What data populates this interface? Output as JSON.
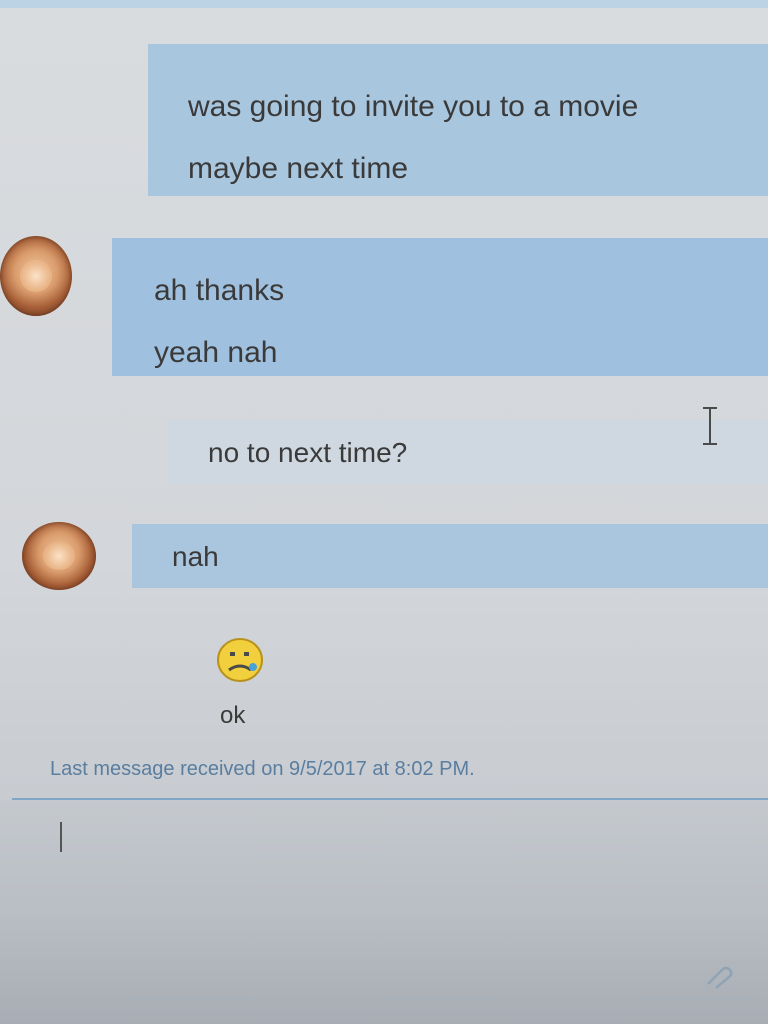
{
  "messages": [
    {
      "lines": [
        "was going to invite you to a movie",
        "maybe next time"
      ]
    },
    {
      "lines": [
        "ah thanks",
        "yeah nah"
      ]
    },
    {
      "lines": [
        "no to next time?"
      ]
    },
    {
      "lines": [
        "nah"
      ]
    },
    {
      "emoji": "worried-face-icon",
      "text": "ok"
    }
  ],
  "status": {
    "last_received": "Last message received on 9/5/2017 at 8:02 PM."
  },
  "compose": {
    "value": ""
  },
  "colors": {
    "bubble_sent": "#a9c6df",
    "bubble_received": "#9fc0de",
    "status_text": "#5a7ea0",
    "divider": "#7fa6c6"
  }
}
